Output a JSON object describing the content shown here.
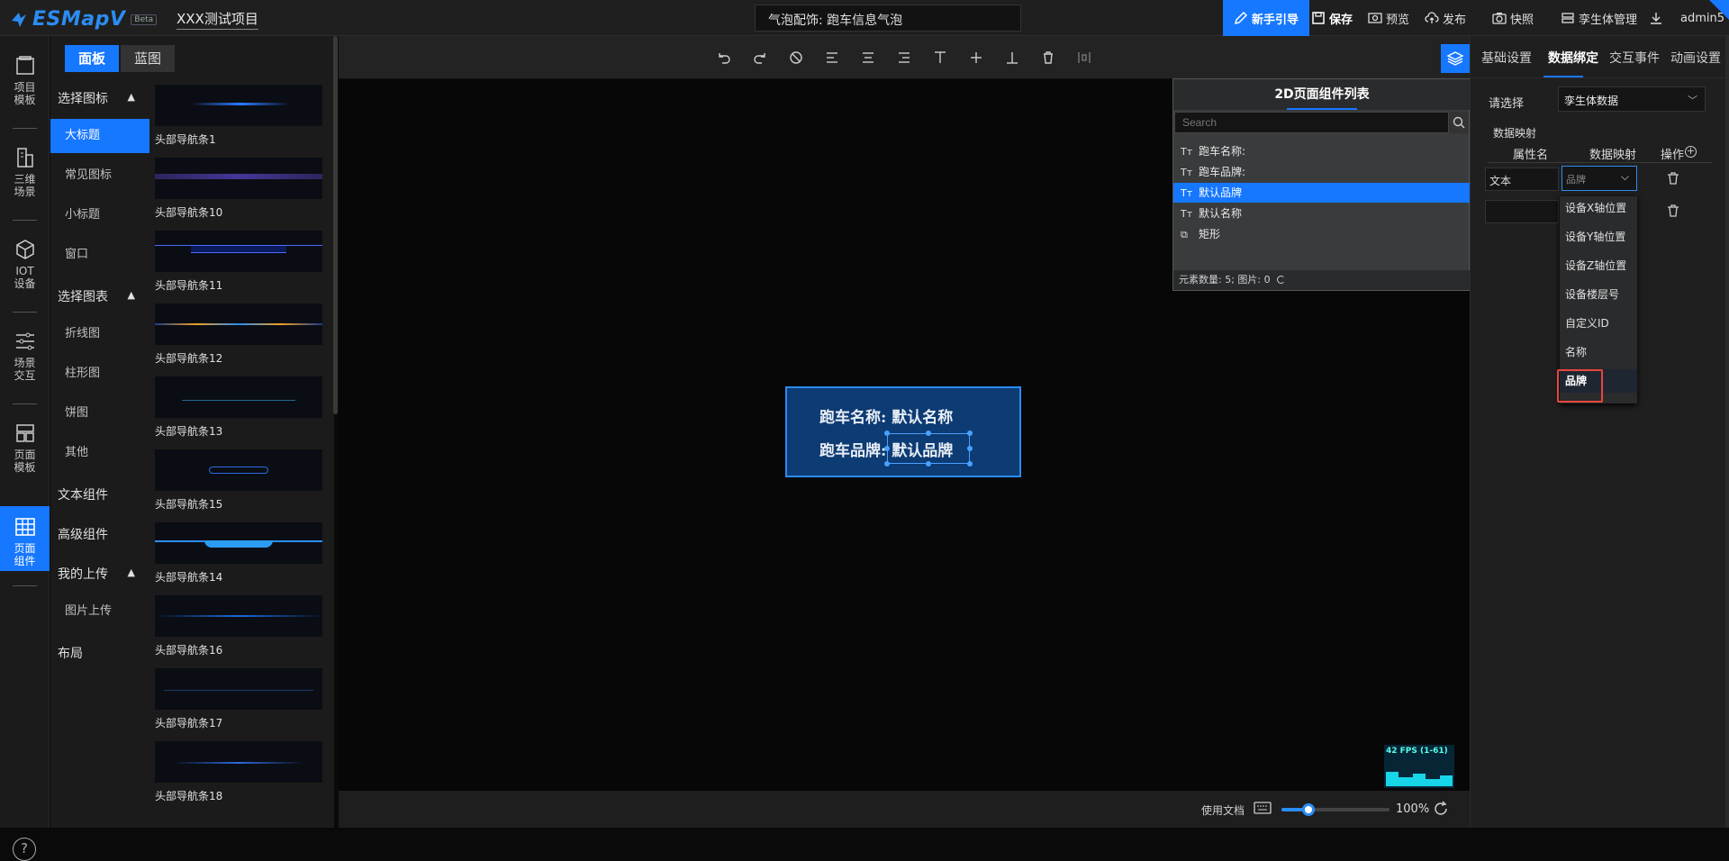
{
  "topbar": {
    "logo_text": "ESMapV",
    "beta": "Beta",
    "project_name": "XXX测试项目",
    "page_selector": "气泡配饰: 跑车信息气泡",
    "actions": {
      "guide": "新手引导",
      "save": "保存",
      "preview": "预览",
      "publish": "发布",
      "snapshot": "快照",
      "twin_manage": "孪生体管理",
      "user": "admin5"
    }
  },
  "rail": {
    "items": [
      {
        "label": "项目\n模板",
        "icon": "project-template-icon"
      },
      {
        "label": "三维\n场景",
        "icon": "building-icon"
      },
      {
        "label": "IOT\n设备",
        "icon": "cube-icon"
      },
      {
        "label": "场景\n交互",
        "icon": "sliders-icon"
      },
      {
        "label": "页面\n模板",
        "icon": "layout-icon"
      },
      {
        "label": "页面\n组件",
        "icon": "table-icon"
      }
    ],
    "help": "?"
  },
  "tabs": {
    "panel": "面板",
    "blueprint": "蓝图"
  },
  "categories": {
    "select_icon": "选择图标",
    "icon_items": [
      "大标题",
      "常见图标",
      "小标题",
      "窗口"
    ],
    "select_chart": "选择图表",
    "chart_items": [
      "折线图",
      "柱形图",
      "饼图",
      "其他"
    ],
    "text_comp": "文本组件",
    "advanced_comp": "高级组件",
    "my_upload": "我的上传",
    "upload_items": [
      "图片上传"
    ],
    "layout": "布局"
  },
  "components": [
    "头部导航条1",
    "头部导航条10",
    "头部导航条11",
    "头部导航条12",
    "头部导航条13",
    "头部导航条15",
    "头部导航条14",
    "头部导航条16",
    "头部导航条17",
    "头部导航条18"
  ],
  "canvas": {
    "line1_label": "跑车名称:",
    "line1_value": "默认名称",
    "line2_label": "跑车品牌:",
    "line2_value": "默认品牌",
    "fps": "42 FPS (1-61)"
  },
  "bottombar": {
    "doc": "使用文档",
    "zoom": "100%",
    "zoom_fraction": 0.25
  },
  "layer_panel": {
    "title": "2D页面组件列表",
    "search_placeholder": "Search",
    "rows": [
      {
        "icon": "Tт",
        "label": "跑车名称:"
      },
      {
        "icon": "Tт",
        "label": "跑车品牌:"
      },
      {
        "icon": "Tт",
        "label": "默认品牌"
      },
      {
        "icon": "Tт",
        "label": "默认名称"
      },
      {
        "icon": "⧉",
        "label": "矩形"
      }
    ],
    "footer": "元素数量: 5; 图片: 0"
  },
  "right_panel": {
    "tabs": [
      "基础设置",
      "数据绑定",
      "交互事件",
      "动画设置"
    ],
    "select_label": "请选择",
    "data_source": "孪生体数据",
    "mapping_title": "数据映射",
    "columns": [
      "属性名",
      "数据映射",
      "操作"
    ],
    "row1_attr": "文本",
    "row1_map_placeholder": "品牌",
    "map_options": [
      "设备X轴位置",
      "设备Y轴位置",
      "设备Z轴位置",
      "设备楼层号",
      "自定义ID",
      "名称",
      "品牌"
    ]
  },
  "colors": {
    "accent": "#1677ff",
    "highlight": "#e8453c",
    "popup_bg": "#0d3b73"
  }
}
